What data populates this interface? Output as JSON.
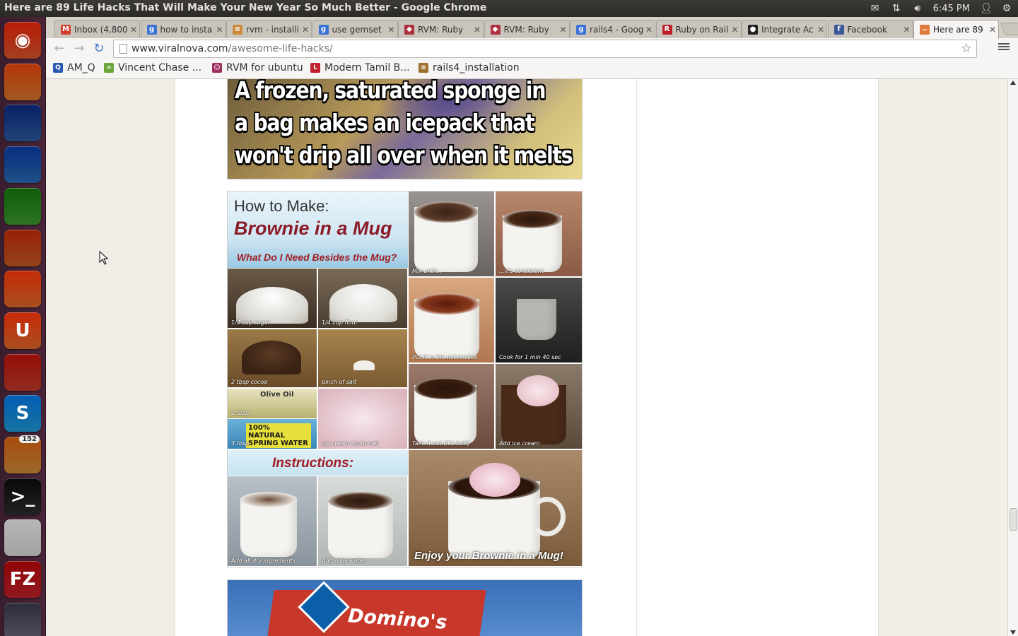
{
  "window": {
    "title": "Here are 89 Life Hacks That Will Make Your New Year So Much Better - Google Chrome"
  },
  "panel": {
    "clock": "6:45 PM"
  },
  "launcher": {
    "items": [
      {
        "name": "ubuntu-dash-icon",
        "glyph": "◉",
        "color": "#d9552b"
      },
      {
        "name": "files-icon",
        "glyph": "",
        "color": "#d7762e"
      },
      {
        "name": "firefox-icon",
        "glyph": "",
        "color": "#2c5aa0"
      },
      {
        "name": "libreoffice-writer-icon",
        "glyph": "",
        "color": "#2a6cb4"
      },
      {
        "name": "libreoffice-calc-icon",
        "glyph": "",
        "color": "#3c9a2e"
      },
      {
        "name": "libreoffice-impress-icon",
        "glyph": "",
        "color": "#c55a23"
      },
      {
        "name": "software-center-icon",
        "glyph": "",
        "color": "#e06a2a"
      },
      {
        "name": "ubuntu-one-icon",
        "glyph": "U",
        "color": "#e2682c"
      },
      {
        "name": "system-settings-icon",
        "glyph": "",
        "color": "#c23b2b"
      },
      {
        "name": "skype-icon",
        "glyph": "S",
        "color": "#1e9ad6"
      },
      {
        "name": "update-manager-icon",
        "glyph": "",
        "color": "#d08a3a",
        "badge": "152"
      },
      {
        "name": "terminal-icon",
        "glyph": ">_",
        "color": "#2e2e2e"
      },
      {
        "name": "chrome-icon",
        "glyph": "",
        "color": "#d8d8d8"
      },
      {
        "name": "filezilla-icon",
        "glyph": "FZ",
        "color": "#c0222a"
      },
      {
        "name": "scanner-icon",
        "glyph": "",
        "color": "#6a6a7a"
      }
    ]
  },
  "tabs": [
    {
      "label": "Inbox (4,800",
      "favicon": "gmail",
      "fav_color": "#d23f31",
      "fav_glyph": "M"
    },
    {
      "label": "how to insta",
      "favicon": "google",
      "fav_color": "#3b73d6",
      "fav_glyph": "g"
    },
    {
      "label": "rvm - installi",
      "favicon": "stackoverflow",
      "fav_color": "#c98a3a",
      "fav_glyph": "≡"
    },
    {
      "label": "use gemset",
      "favicon": "google",
      "fav_color": "#3b73d6",
      "fav_glyph": "g"
    },
    {
      "label": "RVM: Ruby",
      "favicon": "rvm",
      "fav_color": "#b03040",
      "fav_glyph": "◆"
    },
    {
      "label": "RVM: Ruby",
      "favicon": "rvm",
      "fav_color": "#b03040",
      "fav_glyph": "◆"
    },
    {
      "label": "rails4 - Goog",
      "favicon": "google",
      "fav_color": "#3b73d6",
      "fav_glyph": "g"
    },
    {
      "label": "Ruby on Rail",
      "favicon": "rails",
      "fav_color": "#c0202a",
      "fav_glyph": "R"
    },
    {
      "label": "Integrate Ac",
      "favicon": "github",
      "fav_color": "#222222",
      "fav_glyph": "●"
    },
    {
      "label": "Facebook",
      "favicon": "facebook",
      "fav_color": "#3b5998",
      "fav_glyph": "f"
    },
    {
      "label": "Here are 89",
      "favicon": "viralnova",
      "fav_color": "#e07a3a",
      "fav_glyph": "~"
    }
  ],
  "omnibox": {
    "domain": "www.viralnova.com",
    "path": "/awesome-life-hacks/"
  },
  "bookmarks": [
    {
      "label": "AM_Q",
      "color": "#2a5ab0",
      "glyph": "Q"
    },
    {
      "label": "Vincent Chase ...",
      "color": "#6aa63a",
      "glyph": "∞"
    },
    {
      "label": "RVM for ubuntu",
      "color": "#a03060",
      "glyph": "☺"
    },
    {
      "label": "Modern Tamil B...",
      "color": "#c0202a",
      "glyph": "L"
    },
    {
      "label": "rails4_installation",
      "color": "#a07030",
      "glyph": "≡"
    }
  ],
  "article": {
    "sponge_text": [
      "A frozen, saturated sponge in",
      "a bag makes an icepack that",
      "won't drip all over when it melts"
    ],
    "brownie": {
      "title_line1": "How to Make:",
      "title_line2": "Brownie in a Mug",
      "subtitle": "What Do I Need Besides the Mug?",
      "instructions": "Instructions:",
      "enjoy": "Enjoy your Brownie in a Mug!",
      "olive_oil": "Olive Oil",
      "water": "100% NATURAL SPRING WATER",
      "captions": {
        "sugar": "1/4 cup sugar",
        "flour": "1/4 cup flour",
        "cocoa": "2 tbsp cocoa",
        "salt": "pinch of salt",
        "oil": "2 tbsp",
        "water_amt": "3 tbsp",
        "icecream": "ice cream (optional)",
        "mix": "Mix until...",
        "consistent": "...it's consistent",
        "microwave": "Put it in the microwave",
        "cook": "Cook for 1 min 40 sec",
        "takeout": "Take it out (it's hot!)",
        "addice": "Add ice cream",
        "dry": "Add all dry ingredients",
        "oilwater": "Add oil & water"
      }
    },
    "dominos_text": "Domino's"
  }
}
